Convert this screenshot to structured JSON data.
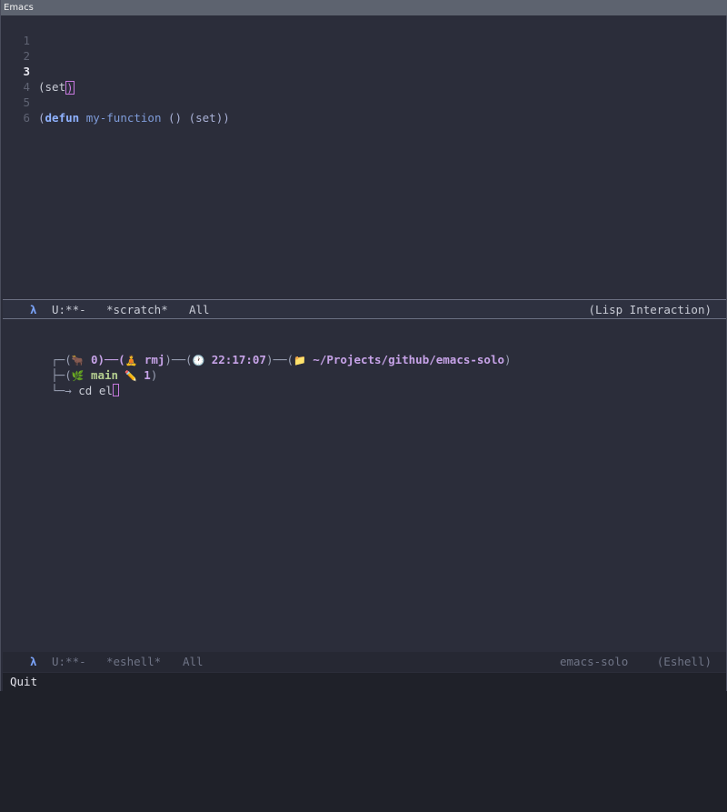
{
  "window": {
    "title": "Emacs"
  },
  "scratch": {
    "lines": [
      {
        "num": "1",
        "text": ""
      },
      {
        "num": "2",
        "text": ""
      },
      {
        "num": "3",
        "code_open": "(set",
        "code_cursor": ")"
      },
      {
        "num": "4",
        "text": ""
      },
      {
        "num": "5",
        "p1": "(",
        "kw": "defun",
        "fn": "my-function",
        "rest": " () (set))"
      },
      {
        "num": "6",
        "text": ""
      }
    ]
  },
  "modeline_top": {
    "lambda": "λ",
    "state": "U:**-",
    "buffer": "*scratch*",
    "position": "All",
    "mode": "(Lisp Interaction)"
  },
  "eshell": {
    "prompt_line1": {
      "start": "┌─(",
      "icon_ox": "🐂",
      "count": " 0)──(",
      "icon_person": "🧘",
      "user": " rmj",
      "sep2": ")──(",
      "icon_clock": "🕐",
      "time": " 22:17:07",
      "sep3": ")──(",
      "icon_folder": "📁",
      "path": " ~/Projects/github/emacs-solo",
      "end": ")"
    },
    "prompt_line2": {
      "start": "├─(",
      "icon_branch": "🌿",
      "branch": " main",
      "icon_pencil": "  ✏️",
      "changes": " 1",
      "end": ")"
    },
    "prompt_line3": {
      "arrow": "└─→ ",
      "command": "cd el"
    }
  },
  "modeline_bottom": {
    "lambda": "λ",
    "state": "U:**-",
    "buffer": "*eshell*",
    "position": "All",
    "project": "emacs-solo",
    "mode": "(Eshell)"
  },
  "minibuffer": {
    "message": "Quit"
  },
  "colors": {
    "background": "#2b2d3a",
    "accent_purple": "#c678dd",
    "keyword_blue": "#8fb2ff",
    "prompt_purple": "#c7a3e8",
    "prompt_green": "#b5cf90"
  }
}
